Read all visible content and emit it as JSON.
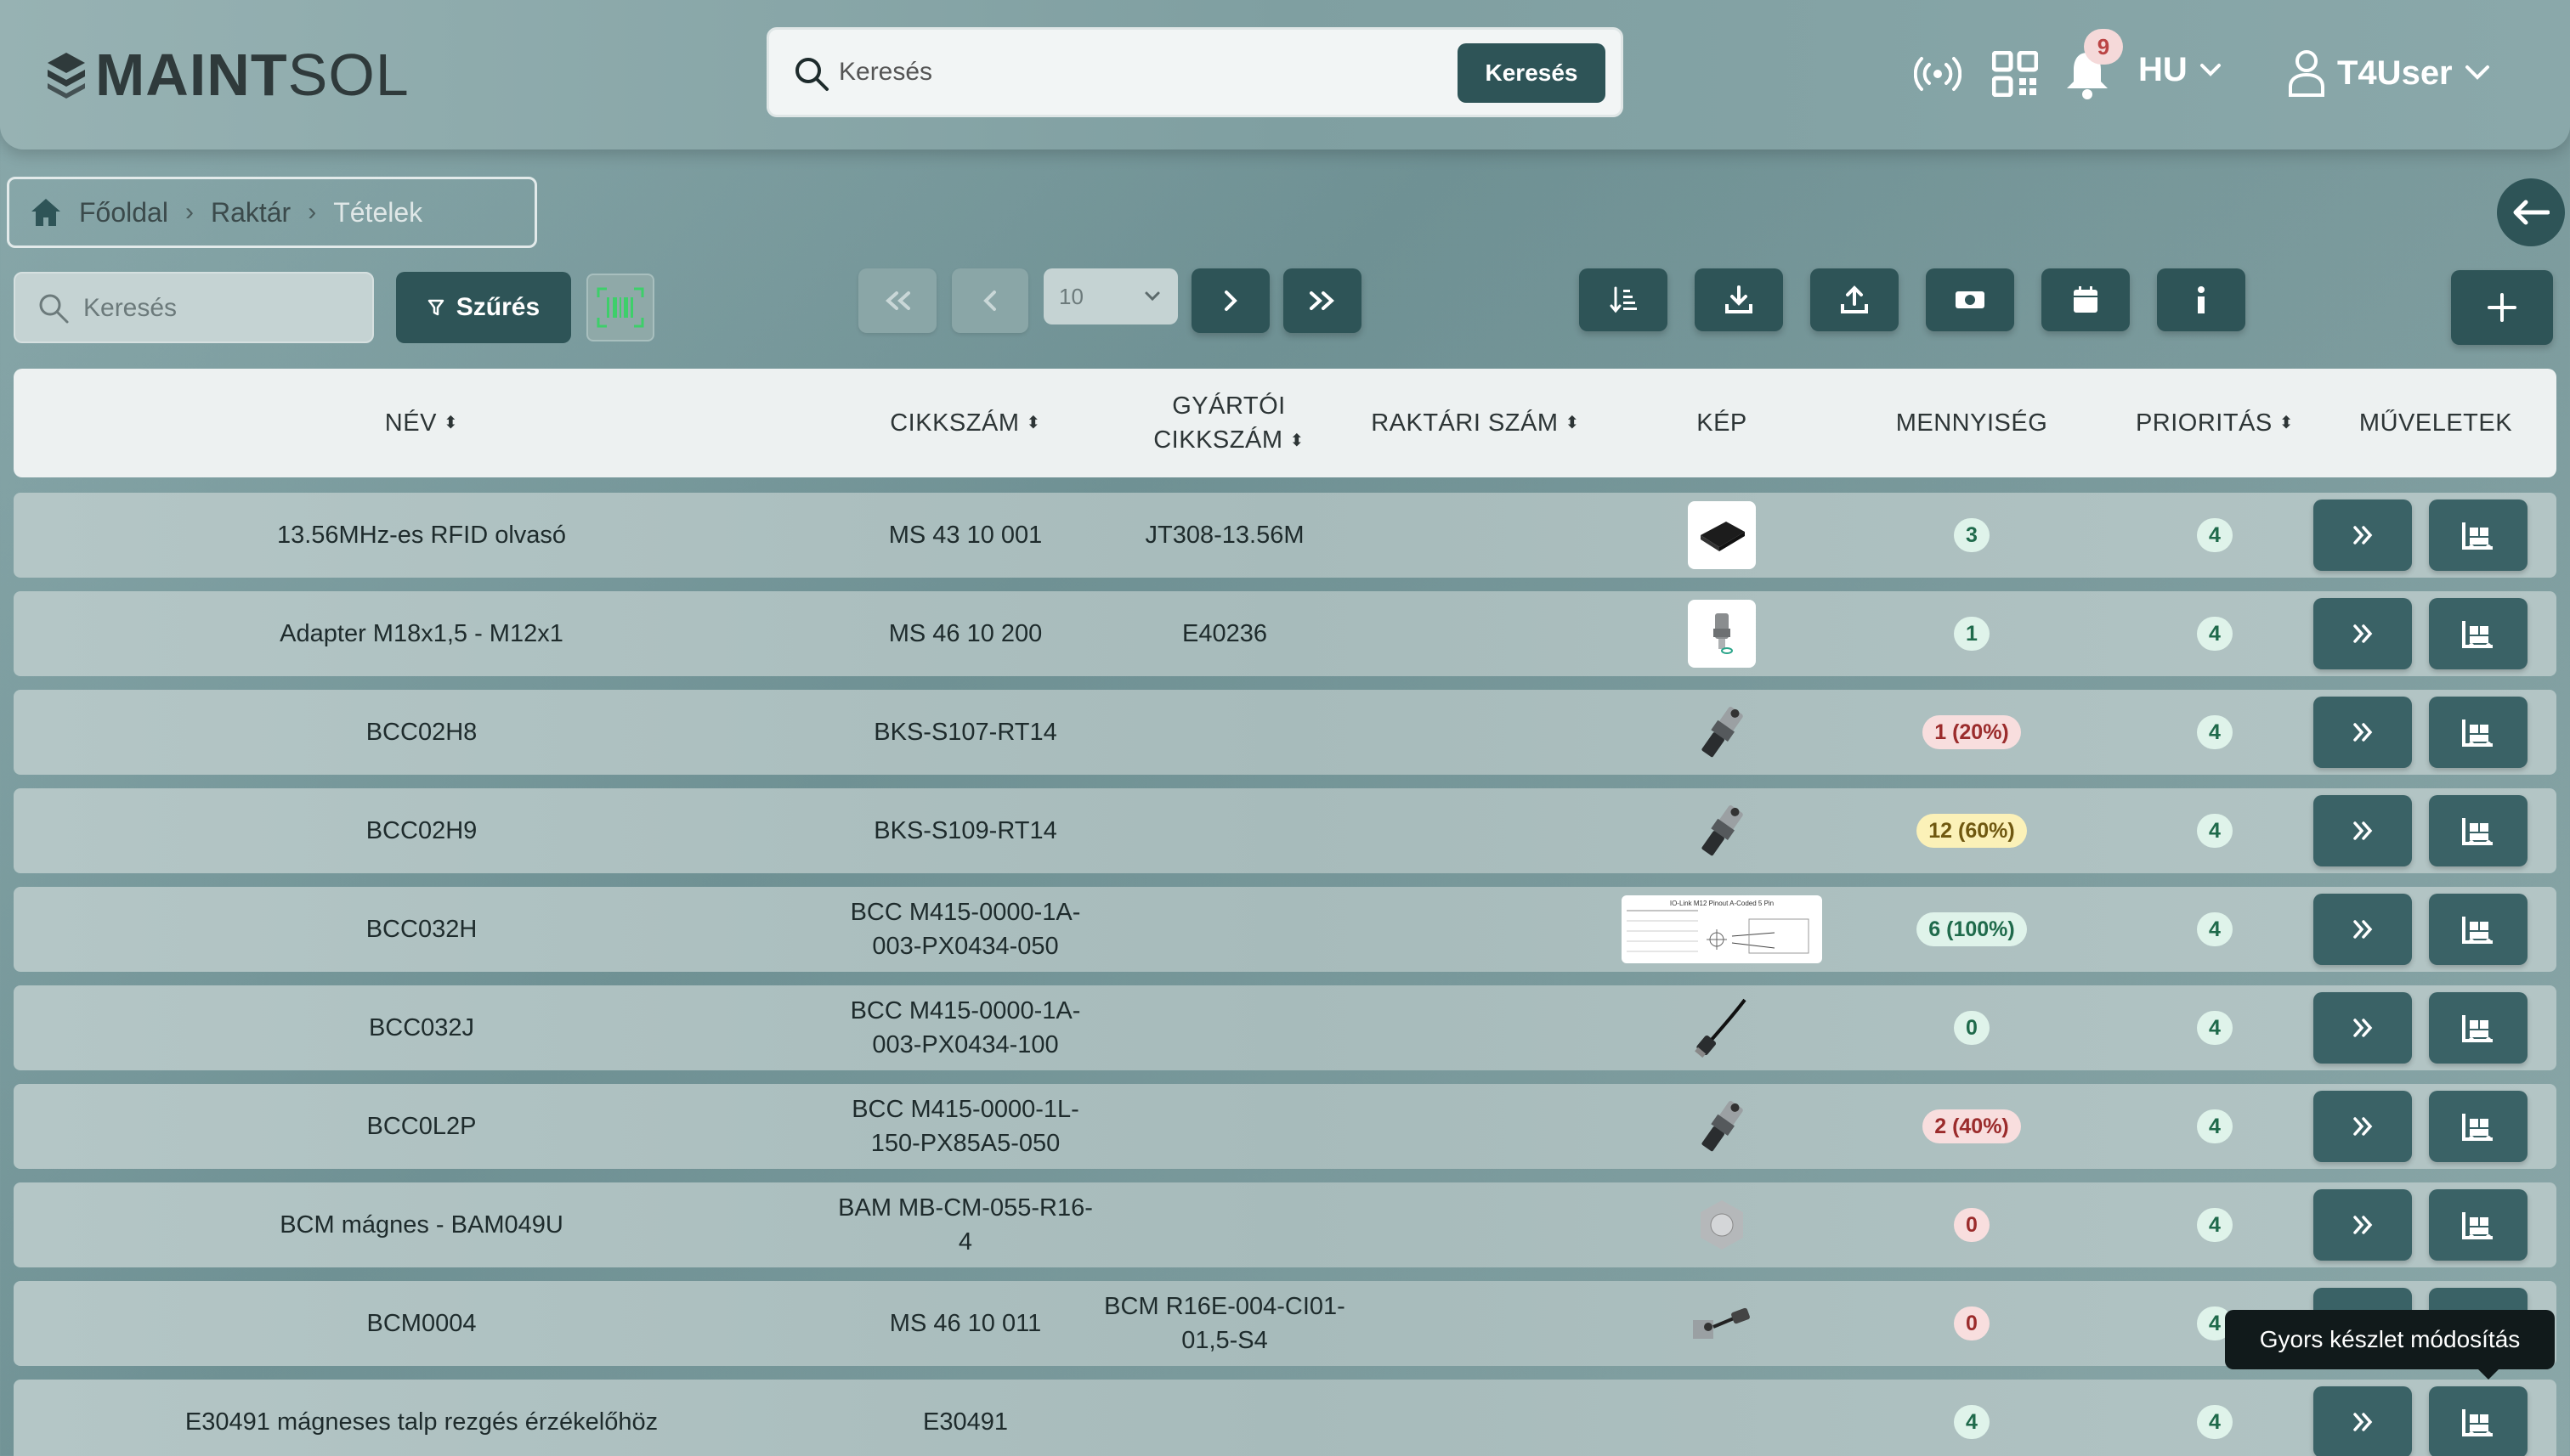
{
  "header": {
    "logo_bold": "MAINT",
    "logo_light": "SOL",
    "search_placeholder": "Keresés",
    "search_button": "Keresés",
    "notification_count": "9",
    "language": "HU",
    "user": "T4User",
    "icons": [
      "rfid-signal-icon",
      "qr-code-icon",
      "bell-icon",
      "chevron-down-icon",
      "user-icon"
    ]
  },
  "breadcrumb": {
    "items": [
      "Főoldal",
      "Raktár",
      "Tételek"
    ]
  },
  "toolbar": {
    "search_placeholder": "Keresés",
    "filter_label": "Szűrés",
    "page_size": "10",
    "action_icons": [
      "sort-icon",
      "download-icon",
      "upload-icon",
      "cash-icon",
      "calendar-icon",
      "info-icon"
    ]
  },
  "table": {
    "headers": {
      "name": "NÉV",
      "article": "CIKKSZÁM",
      "mfr_line1": "GYÁRTÓI",
      "mfr_line2": "CIKKSZÁM",
      "stock_no": "RAKTÁRI SZÁM",
      "image": "KÉP",
      "quantity": "MENNYISÉG",
      "priority": "PRIORITÁS",
      "actions": "MŰVELETEK"
    },
    "rows": [
      {
        "name": "13.56MHz-es RFID olvasó",
        "article": "MS 43 10 001",
        "mfr": "JT308-13.56M",
        "stock": "",
        "image": "rfid-reader-image",
        "qty": "3",
        "qty_status": "green",
        "priority": "4"
      },
      {
        "name": "Adapter M18x1,5 - M12x1",
        "article": "MS 46 10 200",
        "mfr": "E40236",
        "stock": "",
        "image": "adapter-image",
        "qty": "1",
        "qty_status": "green",
        "priority": "4"
      },
      {
        "name": "BCC02H8",
        "article": "BKS-S107-RT14",
        "mfr": "",
        "stock": "",
        "image": "connector-image",
        "qty": "1 (20%)",
        "qty_status": "red",
        "priority": "4"
      },
      {
        "name": "BCC02H9",
        "article": "BKS-S109-RT14",
        "mfr": "",
        "stock": "",
        "image": "connector-image",
        "qty": "12 (60%)",
        "qty_status": "yellow",
        "priority": "4"
      },
      {
        "name": "BCC032H",
        "article": "BCC M415-0000-1A-003-PX0434-050",
        "mfr": "",
        "stock": "",
        "image": "datasheet-image",
        "qty": "6 (100%)",
        "qty_status": "green",
        "priority": "4"
      },
      {
        "name": "BCC032J",
        "article": "BCC M415-0000-1A-003-PX0434-100",
        "mfr": "",
        "stock": "",
        "image": "cable-image",
        "qty": "0",
        "qty_status": "green",
        "priority": "4"
      },
      {
        "name": "BCC0L2P",
        "article": "BCC M415-0000-1L-150-PX85A5-050",
        "mfr": "",
        "stock": "",
        "image": "connector-image",
        "qty": "2 (40%)",
        "qty_status": "red",
        "priority": "4"
      },
      {
        "name": "BCM mágnes - BAM049U",
        "article": "BAM MB-CM-055-R16-4",
        "mfr": "",
        "stock": "",
        "image": "magnet-image",
        "qty": "0",
        "qty_status": "red",
        "priority": "4"
      },
      {
        "name": "BCM0004",
        "article": "MS 46 10 011",
        "mfr": "BCM R16E-004-CI01-01,5-S4",
        "stock": "",
        "image": "sensor-image",
        "qty": "0",
        "qty_status": "red",
        "priority": "4"
      },
      {
        "name": "E30491 mágneses talp rezgés érzékelőhöz",
        "article": "E30491",
        "mfr": "",
        "stock": "",
        "image": "",
        "qty": "4",
        "qty_status": "green",
        "priority": "4"
      }
    ]
  },
  "tooltip": "Gyors készlet módosítás",
  "colors": {
    "accent": "#2e5457",
    "qty_green_bg": "#dff3ea",
    "qty_red_bg": "#f8dede",
    "qty_yellow_bg": "#fbf1b8"
  }
}
